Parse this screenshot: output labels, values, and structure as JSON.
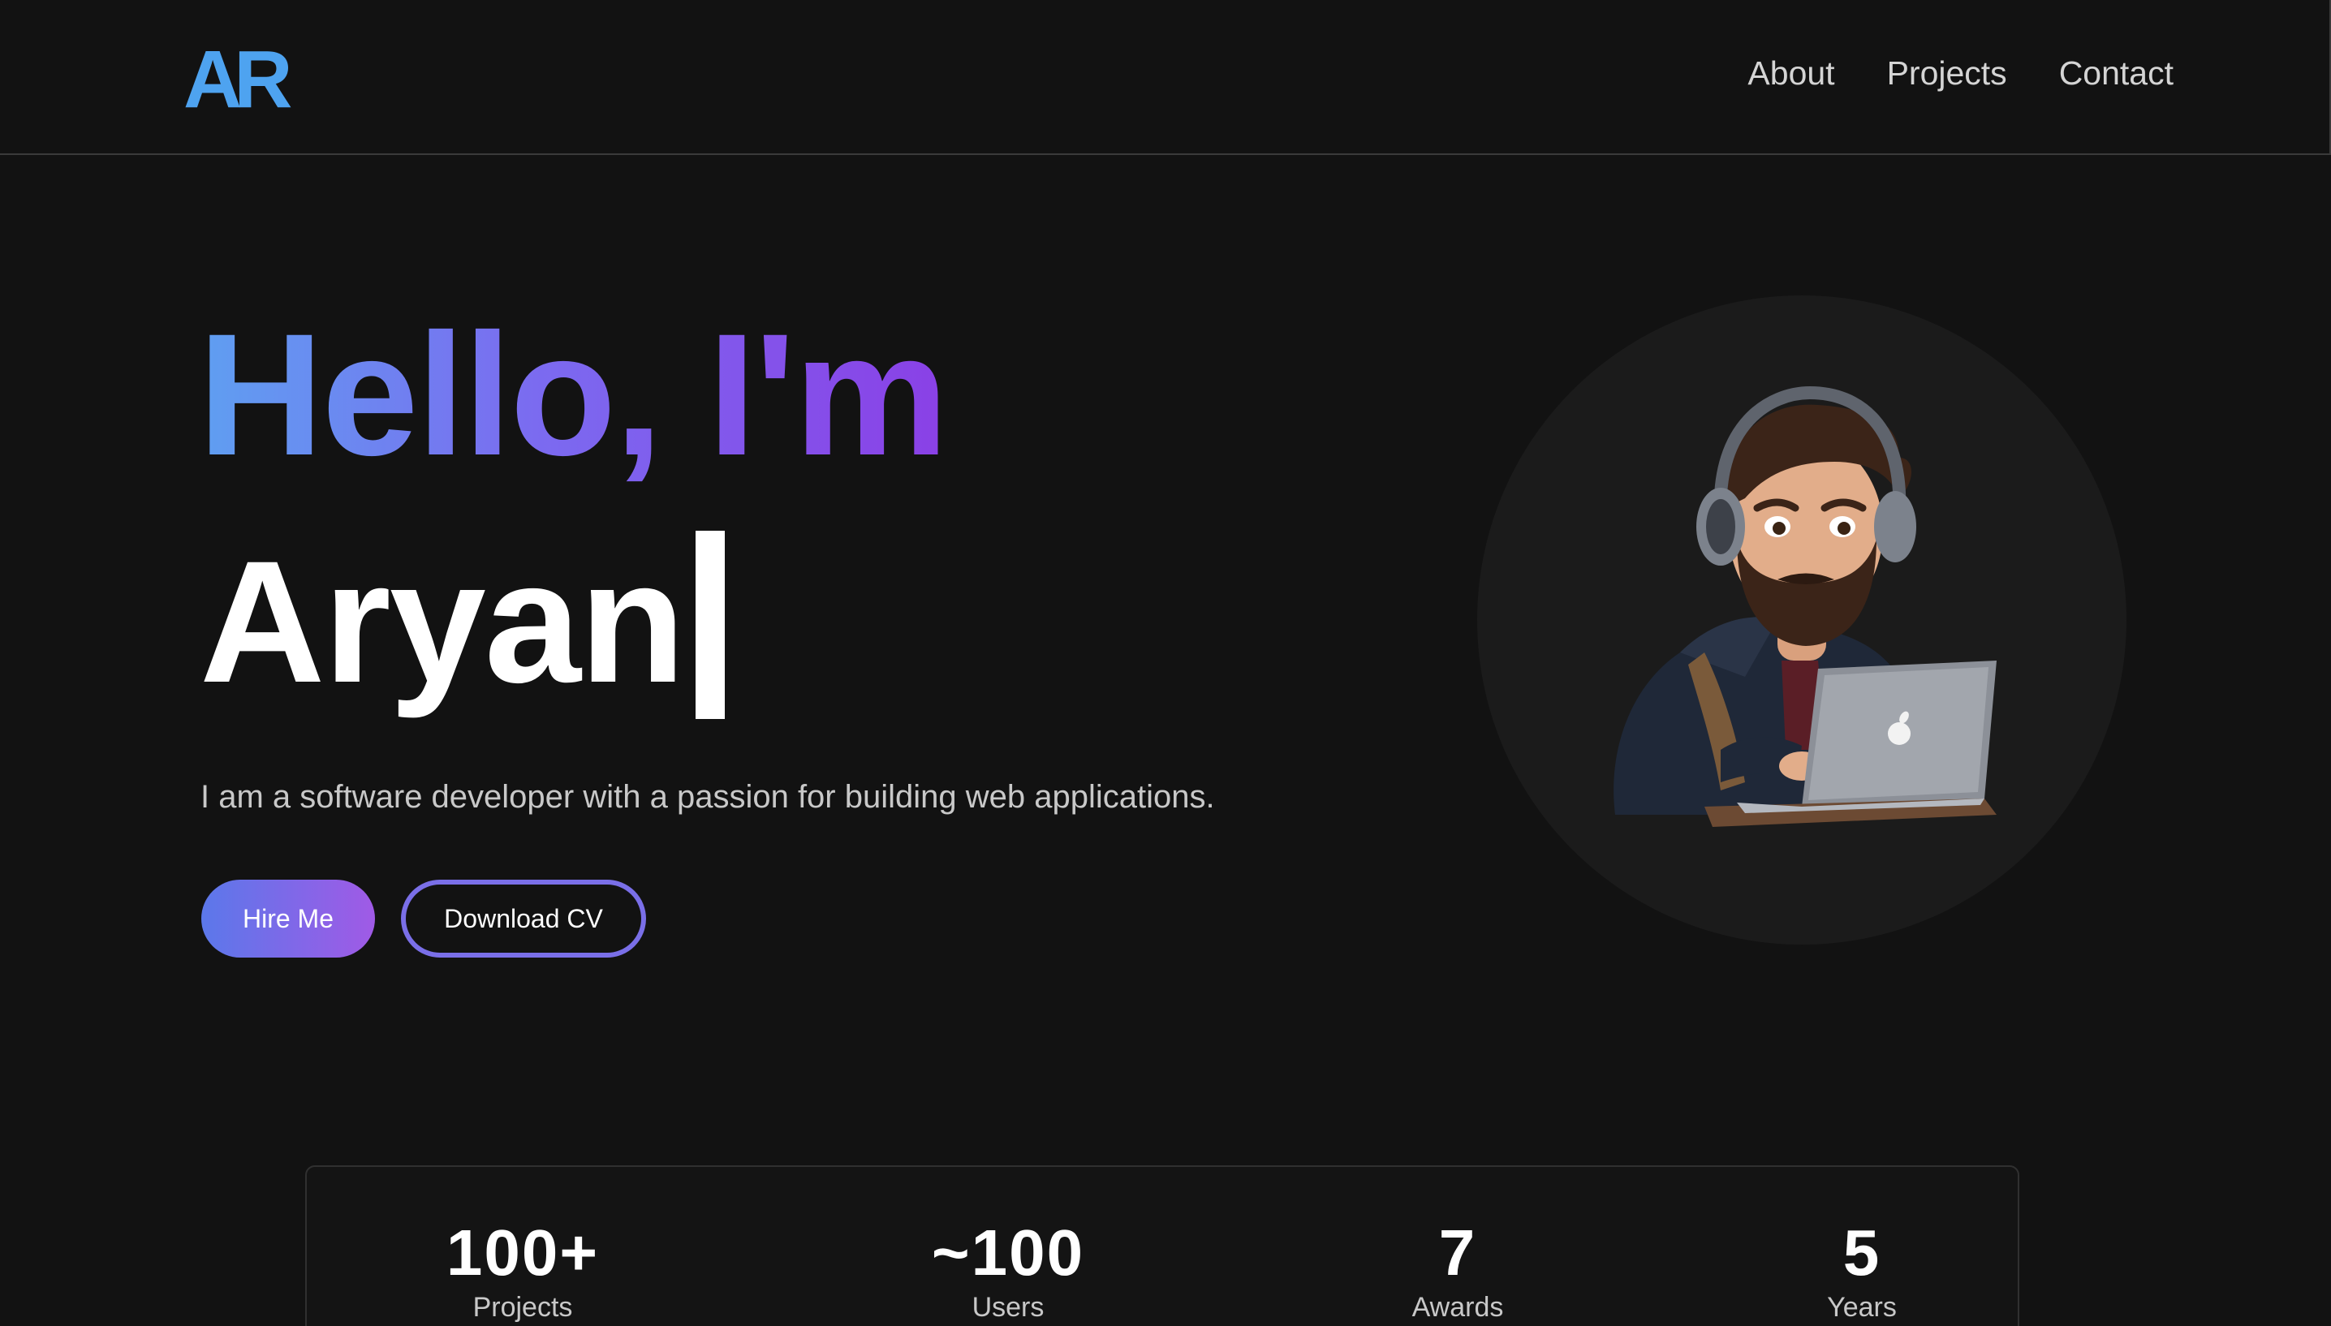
{
  "header": {
    "logo": "AR",
    "nav": [
      "About",
      "Projects",
      "Contact"
    ]
  },
  "hero": {
    "greeting": "Hello, I'm",
    "name": "Aryan",
    "tagline": "I am a software developer with a passion for building web applications.",
    "buttons": {
      "hire": "Hire Me",
      "download_cv": "Download CV"
    }
  },
  "stats": [
    {
      "value": "100+",
      "label": "Projects"
    },
    {
      "value": "~100",
      "label": "Users"
    },
    {
      "value": "7",
      "label": "Awards"
    },
    {
      "value": "5",
      "label": "Years"
    }
  ],
  "colors": {
    "background": "#121212",
    "logo": "#4ea3f0",
    "gradient_start": "#5f9ff1",
    "gradient_end": "#8a40e6",
    "button_gradient_start": "#5b78ea",
    "button_gradient_end": "#a05ae6"
  },
  "icons": {
    "avatar": "developer-avatar-with-headphones-and-laptop"
  }
}
